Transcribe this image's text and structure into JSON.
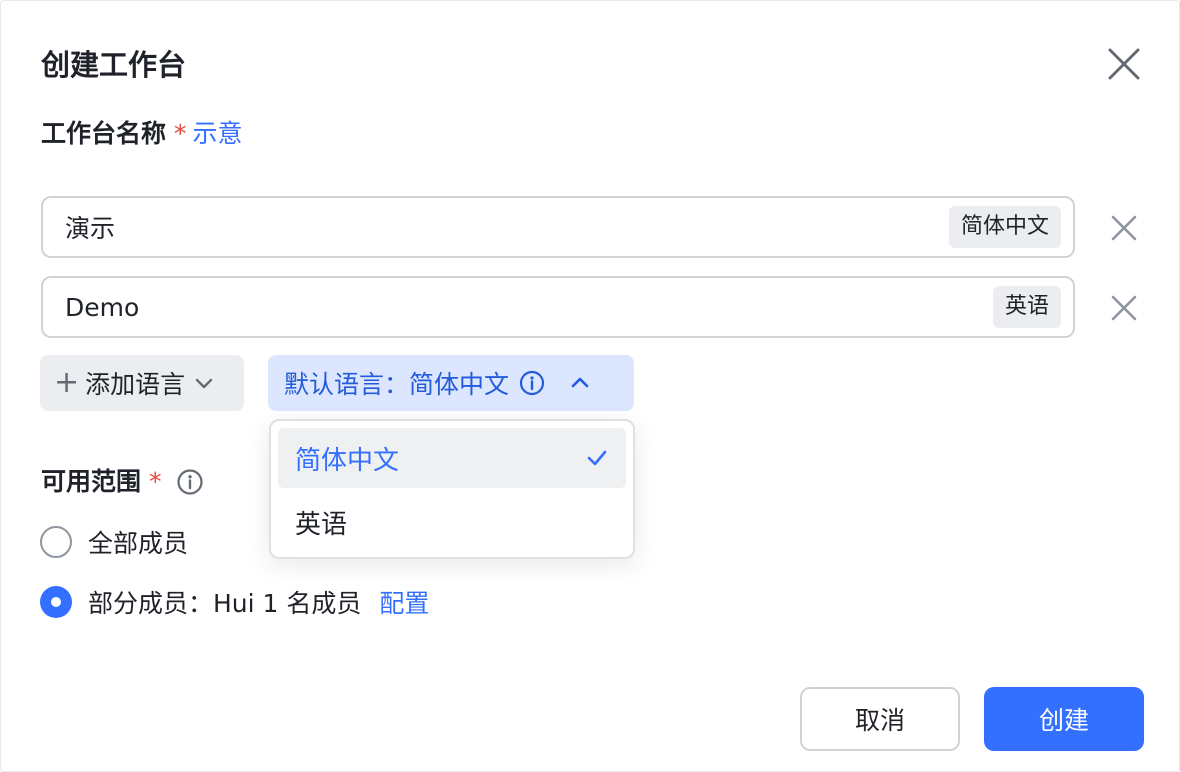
{
  "dialog": {
    "title": "创建工作台",
    "close_icon": "close-icon"
  },
  "name_field": {
    "label": "工作台名称",
    "required_mark": "*",
    "example_link": "示意",
    "entries": [
      {
        "value": "演示",
        "language": "简体中文"
      },
      {
        "value": "Demo",
        "language": "英语"
      }
    ],
    "add_language_label": "添加语言",
    "default_language_label": "默认语言：简体中文"
  },
  "language_dropdown": {
    "options": [
      {
        "label": "简体中文",
        "selected": true
      },
      {
        "label": "英语",
        "selected": false
      }
    ]
  },
  "scope": {
    "label": "可用范围",
    "required_mark": "*",
    "options": [
      {
        "label": "全部成员",
        "checked": false
      },
      {
        "label": "部分成员：Hui 1 名成员",
        "checked": true,
        "link": "配置"
      }
    ]
  },
  "footer": {
    "cancel_label": "取消",
    "create_label": "创建"
  },
  "colors": {
    "primary": "#3370ff",
    "required": "#e5483e",
    "tag_bg": "#ebedf0"
  }
}
